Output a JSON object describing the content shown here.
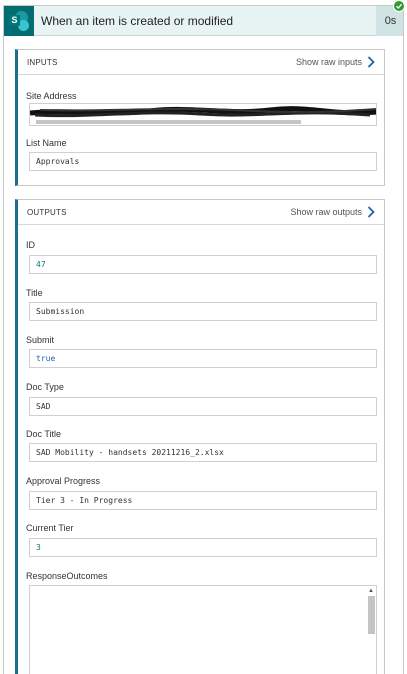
{
  "trigger": {
    "title": "When an item is created or modified",
    "duration": "0s",
    "icon": "sharepoint-icon",
    "status": "succeeded",
    "status_color": "#2e9b2e"
  },
  "inputs": {
    "section_label": "INPUTS",
    "raw_link": "Show raw inputs",
    "fields": [
      {
        "label": "Site Address",
        "value": ""
      },
      {
        "label": "List Name",
        "value": "Approvals"
      }
    ]
  },
  "outputs": {
    "section_label": "OUTPUTS",
    "raw_link": "Show raw outputs",
    "fields": [
      {
        "label": "ID",
        "value": "47"
      },
      {
        "label": "Title",
        "value": "Submission"
      },
      {
        "label": "Submit",
        "value": "true"
      },
      {
        "label": "Doc Type",
        "value": "SAD"
      },
      {
        "label": "Doc Title",
        "value": "SAD Mobility - handsets 20211216_2.xlsx"
      },
      {
        "label": "Approval Progress",
        "value": "Tier 3 - In Progress"
      },
      {
        "label": "Current Tier",
        "value": "3"
      },
      {
        "label": "ResponseOutcomes",
        "value": ""
      }
    ]
  },
  "colors": {
    "accent": "#1e6f8f",
    "link_chevron": "#1e64b0",
    "number_value": "#0b7a6e",
    "boolean_value": "#1e64b0"
  }
}
